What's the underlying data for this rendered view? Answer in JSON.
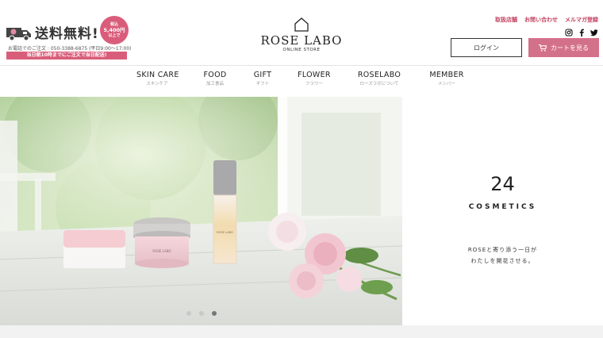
{
  "promo": {
    "title": "送料無料!",
    "badge_line1": "税込",
    "badge_line2": "5,400円",
    "badge_line3": "以上で",
    "phone": "お電話でのご注文 : 050-3388-6875 (平日9:00〜17:00)",
    "band": "当日朝10時までにご注文で当日配送!"
  },
  "logo": {
    "name": "ROSE LABO",
    "sub": "ONLINE STORE"
  },
  "util_links": [
    "取扱店舗",
    "お問い合わせ",
    "メルマガ登録"
  ],
  "social": [
    "instagram-icon",
    "facebook-icon",
    "twitter-icon"
  ],
  "buttons": {
    "login": "ログイン",
    "cart": "カートを見る"
  },
  "nav": [
    {
      "en": "SKIN CARE",
      "jp": "スキンケア"
    },
    {
      "en": "FOOD",
      "jp": "加工食品"
    },
    {
      "en": "GIFT",
      "jp": "ギフト"
    },
    {
      "en": "FLOWER",
      "jp": "フラワー"
    },
    {
      "en": "ROSELABO",
      "jp": "ローズラボについて"
    },
    {
      "en": "MEMBER",
      "jp": "メンバー"
    }
  ],
  "hero": {
    "jar_label": "ROSE LABO",
    "bottle_label": "ROSE LABO",
    "active_slide": 3,
    "slide_count": 3
  },
  "panel": {
    "number": "24",
    "category": "COSMETICS",
    "copy_line1": "ROSEと寄り添う一日が",
    "copy_line2": "わたしを開花させる。"
  },
  "colors": {
    "accent": "#d4718a",
    "accent_text": "#c2405f",
    "nav_text": "#222222"
  }
}
